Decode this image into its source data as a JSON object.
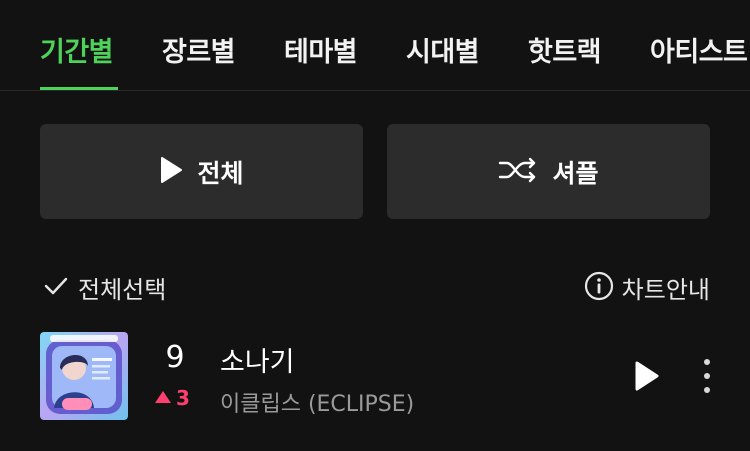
{
  "tabs": [
    {
      "label": "기간별"
    },
    {
      "label": "장르별"
    },
    {
      "label": "테마별"
    },
    {
      "label": "시대별"
    },
    {
      "label": "핫트랙"
    },
    {
      "label": "아티스트"
    }
  ],
  "actions": {
    "play_all_label": "전체",
    "shuffle_label": "셔플"
  },
  "list_controls": {
    "select_all_label": "전체선택",
    "chart_info_label": "차트안내"
  },
  "songs": [
    {
      "rank": "9",
      "rank_change": "3",
      "rank_direction": "up",
      "title": "소나기",
      "artist": "이클립스 (ECLIPSE)"
    }
  ],
  "colors": {
    "accent": "#4ed25a",
    "background": "#121212",
    "button_bg": "#2c2c2c",
    "rank_up": "#ff3f6e",
    "secondary_text": "#9a9a9a"
  }
}
